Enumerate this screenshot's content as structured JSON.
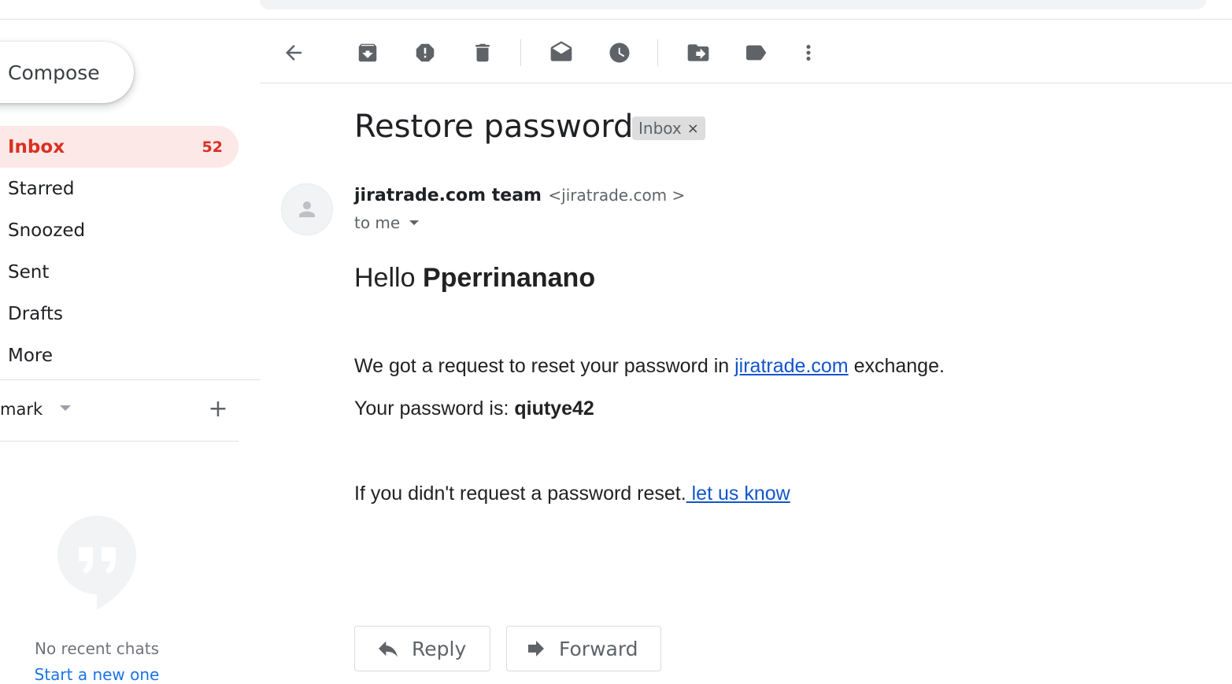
{
  "sidebar": {
    "compose_label": "Compose",
    "items": [
      {
        "label": "Inbox",
        "count": "52"
      },
      {
        "label": "Starred"
      },
      {
        "label": "Snoozed"
      },
      {
        "label": "Sent"
      },
      {
        "label": "Drafts"
      },
      {
        "label": "More"
      }
    ],
    "account_label": "mark",
    "add_label": "+",
    "chat": {
      "empty_text": "No recent chats",
      "start_link": "Start a new one"
    }
  },
  "toolbar": {
    "icons": [
      "back-arrow-icon",
      "archive-icon",
      "report-spam-icon",
      "delete-icon",
      "mark-unread-icon",
      "snooze-icon",
      "move-to-icon",
      "label-icon",
      "more-vert-icon"
    ]
  },
  "message": {
    "subject": "Restore password",
    "label_chip": "Inbox",
    "label_remove": "×",
    "sender_name": "jiratrade.com team",
    "sender_email": "<jiratrade.com >",
    "to_me": "to me",
    "greeting": "Hello",
    "greeting_name": "Pperrinanano",
    "line1_before": "We got a request to reset your password in ",
    "line1_link": "jiratrade.com",
    "line1_after": " exchange.",
    "line2_label": "Your password is: ",
    "line2_value": "qiutye42",
    "line3_text": "If you didn't request a password reset.",
    "line3_link": " let us know"
  },
  "actions": {
    "reply_label": "Reply",
    "forward_label": "Forward"
  },
  "colors": {
    "accent_red": "#d93025",
    "active_bg": "#fce8e6",
    "link_blue": "#1155cc"
  }
}
